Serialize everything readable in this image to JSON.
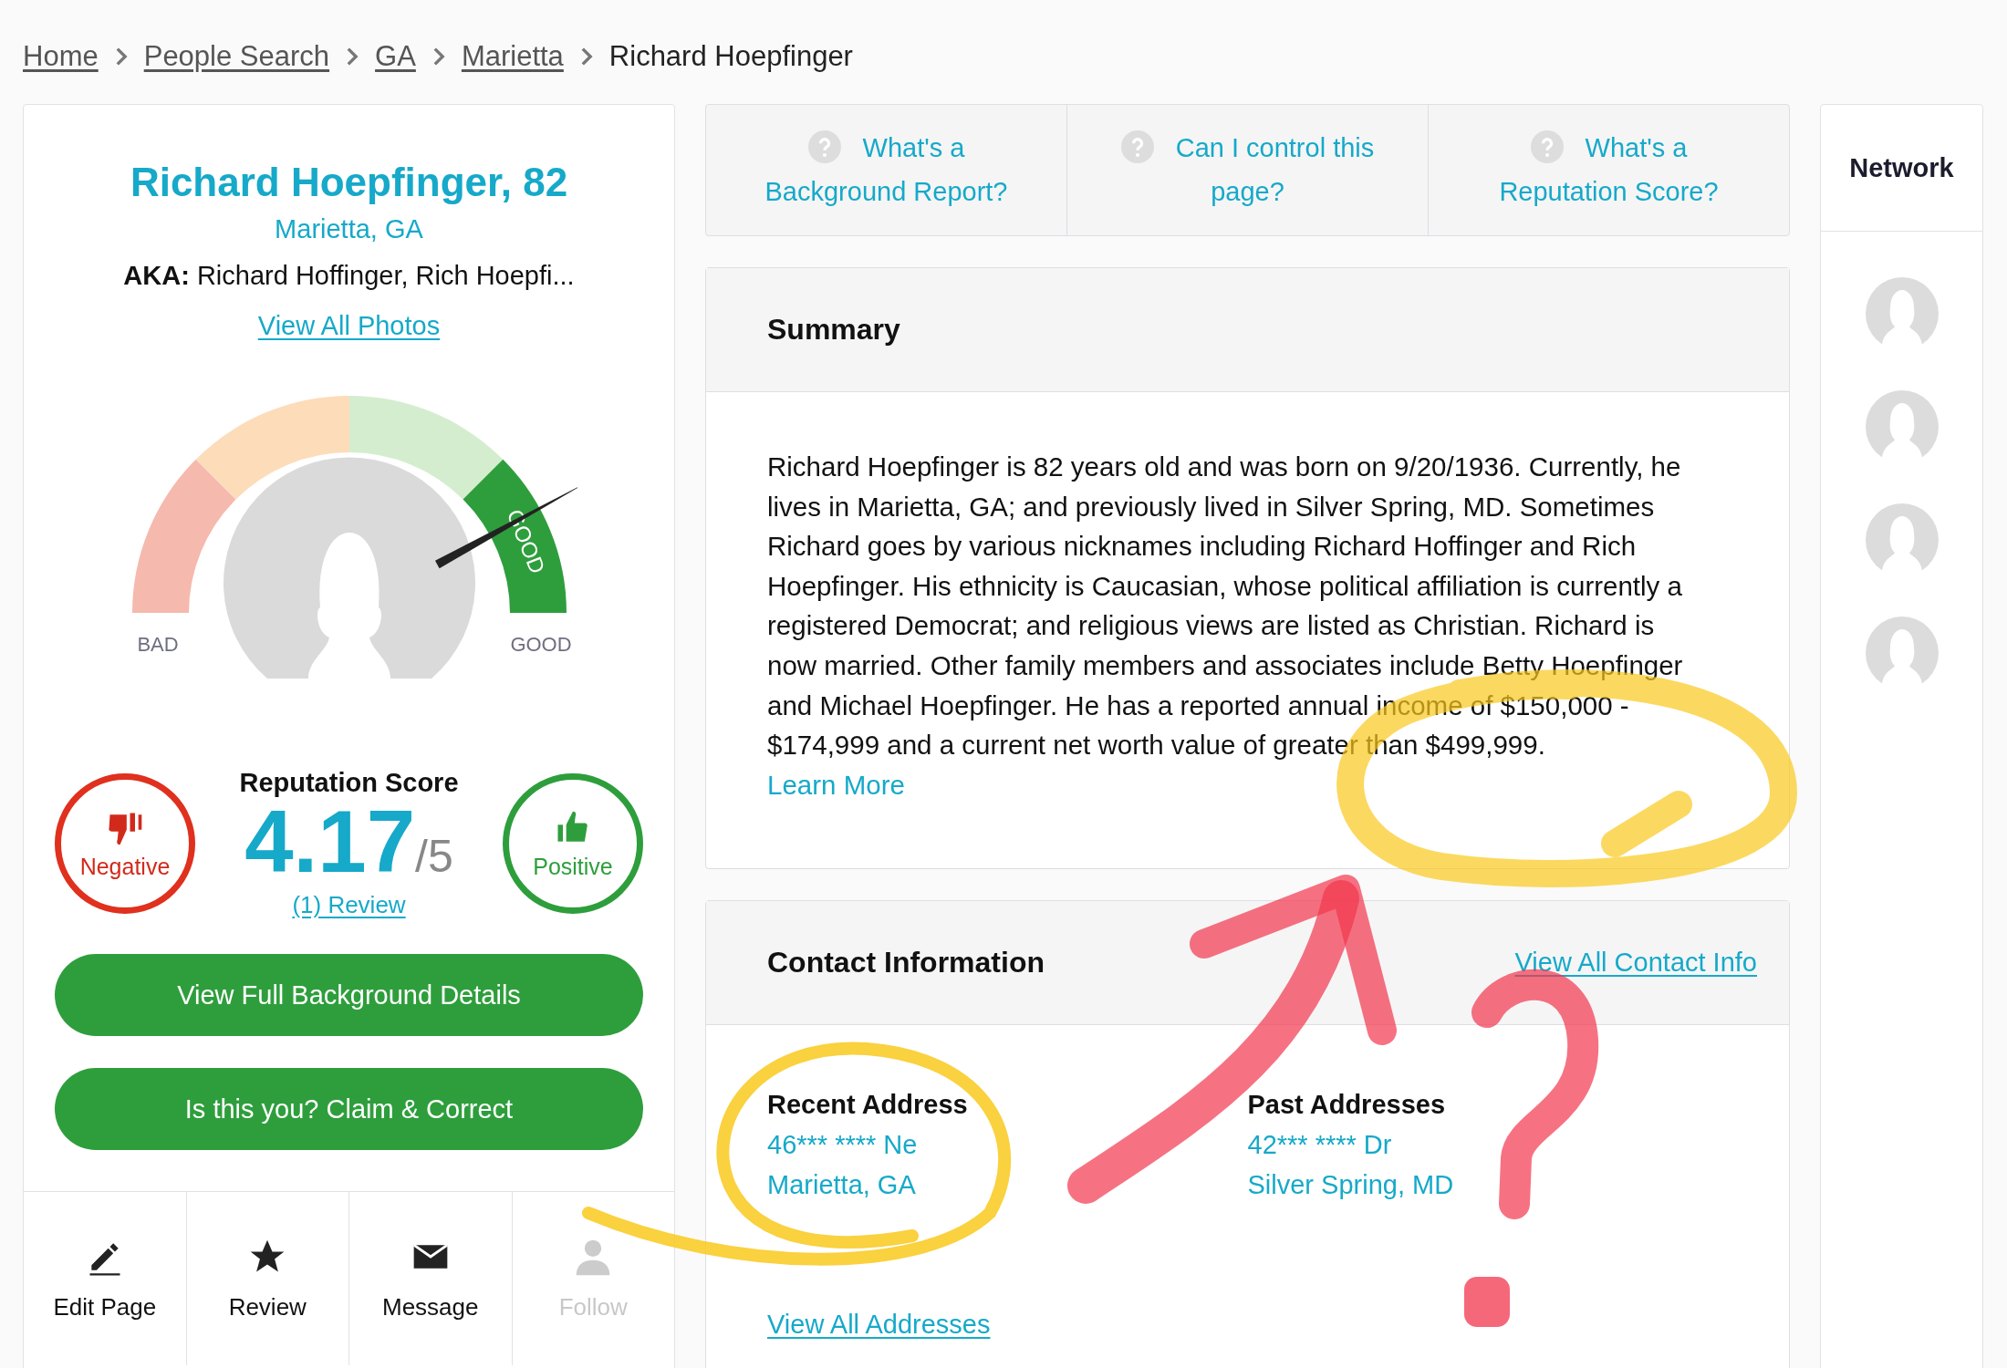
{
  "breadcrumb": [
    {
      "label": "Home",
      "kind": "link"
    },
    {
      "label": "People Search",
      "kind": "link"
    },
    {
      "label": "GA",
      "kind": "link"
    },
    {
      "label": "Marietta",
      "kind": "link"
    },
    {
      "label": "Richard Hoepfinger",
      "kind": "current"
    }
  ],
  "profile": {
    "name": "Richard Hoepfinger, 82",
    "location": "Marietta, GA",
    "aka_label": "AKA:",
    "aka": "Richard Hoffinger, Rich Hoepfi...",
    "photos_link": "View All Photos",
    "gauge": {
      "low_label": "BAD",
      "high_label": "GOOD",
      "band_label": "GOOD",
      "level": 0.84
    },
    "negative_label": "Negative",
    "score_title": "Reputation Score",
    "score": "4.17",
    "score_max": "/5",
    "review_link": "(1) Review",
    "positive_label": "Positive",
    "buttons": [
      "View Full Background Details",
      "Is this you? Claim & Correct"
    ],
    "actions": [
      {
        "kind": "edit",
        "label": "Edit Page",
        "disabled": false
      },
      {
        "kind": "star",
        "label": "Review",
        "disabled": false
      },
      {
        "kind": "mail",
        "label": "Message",
        "disabled": false
      },
      {
        "kind": "person",
        "label": "Follow",
        "disabled": true
      }
    ]
  },
  "info_tabs": [
    {
      "label": "What's a Background Report?"
    },
    {
      "label": "Can I control this page?"
    },
    {
      "label": "What's a Reputation Score?"
    }
  ],
  "summary": {
    "title": "Summary",
    "text": "Richard Hoepfinger is 82 years old and was born on 9/20/1936. Currently, he lives in Marietta, GA; and previously lived in Silver Spring, MD. Sometimes Richard goes by various nicknames including Richard Hoffinger and Rich Hoepfinger. His ethnicity is Caucasian, whose political affiliation is currently a registered Democrat; and religious views are listed as Christian. Richard is now married. Other family members and associates include Betty Hoepfinger and Michael Hoepfinger. He has a reported annual income of $150,000 - $174,999 and a current net worth value of greater than $499,999.",
    "link": "Learn More"
  },
  "contact": {
    "title": "Contact Information",
    "link": "View All Contact Info",
    "columns": [
      {
        "heading": "Recent Address",
        "lines": [
          "46*** **** Ne",
          "Marietta, GA"
        ]
      },
      {
        "heading": "Past Addresses",
        "lines": [
          "42*** **** Dr",
          "Silver Spring, MD"
        ]
      }
    ],
    "footer_link": "View All Addresses"
  },
  "network": {
    "title": "Network",
    "members": [
      {
        "kind": "avatar"
      },
      {
        "kind": "avatar"
      },
      {
        "kind": "avatar"
      },
      {
        "kind": "avatar"
      }
    ]
  },
  "annotations": [
    {
      "kind": "circle"
    },
    {
      "kind": "loop"
    },
    {
      "kind": "arrow"
    },
    {
      "kind": "question"
    }
  ]
}
